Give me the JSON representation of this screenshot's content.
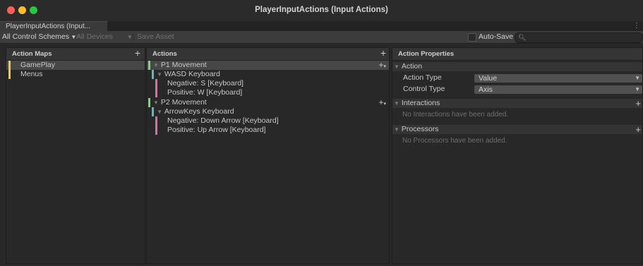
{
  "window": {
    "title": "PlayerInputActions (Input Actions)"
  },
  "tab": {
    "label": "PlayerInputActions (Input...",
    "menu": "⋮"
  },
  "toolbar": {
    "control_schemes": "All Control Schemes",
    "devices": "All Devices",
    "save_asset": "Save Asset",
    "auto_save": "Auto-Save"
  },
  "action_maps": {
    "header": "Action Maps",
    "items": [
      {
        "label": "GamePlay",
        "color": "#e6c86e"
      },
      {
        "label": "Menus",
        "color": "#e6c86e"
      }
    ]
  },
  "actions": {
    "header": "Actions",
    "rows": [
      {
        "label": "P1 Movement"
      },
      {
        "label": "WASD Keyboard"
      },
      {
        "label": "Negative: S [Keyboard]"
      },
      {
        "label": "Positive: W [Keyboard]"
      },
      {
        "label": "P2 Movement"
      },
      {
        "label": "ArrowKeys Keyboard"
      },
      {
        "label": "Negative: Down Arrow [Keyboard]"
      },
      {
        "label": "Positive: Up Arrow [Keyboard]"
      }
    ]
  },
  "properties": {
    "header": "Action Properties",
    "action_section": "Action",
    "action_type_label": "Action Type",
    "action_type_value": "Value",
    "control_type_label": "Control Type",
    "control_type_value": "Axis",
    "interactions_section": "Interactions",
    "interactions_empty": "No Interactions have been added.",
    "processors_section": "Processors",
    "processors_empty": "No Processors have been added."
  },
  "colors": {
    "action": "#8cc98c",
    "binding": "#6eb4b4",
    "part": "#c87a9a",
    "map": "#e6c86e"
  }
}
